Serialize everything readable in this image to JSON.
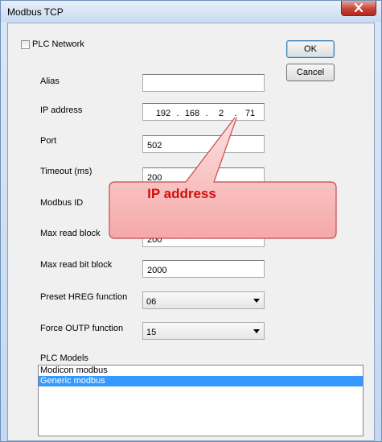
{
  "window": {
    "title": "Modbus TCP"
  },
  "plc_network": {
    "label": "PLC Network",
    "checked": false
  },
  "buttons": {
    "ok": "OK",
    "cancel": "Cancel"
  },
  "fields": {
    "alias": {
      "label": "Alias",
      "value": ""
    },
    "ip_address": {
      "label": "IP address",
      "octets": [
        "192",
        "168",
        "2",
        "71"
      ]
    },
    "port": {
      "label": "Port",
      "value": "502"
    },
    "timeout": {
      "label": "Timeout (ms)",
      "value": "200"
    },
    "modbus_id": {
      "label": "Modbus ID",
      "value": ""
    },
    "max_read_block": {
      "label": "Max read block",
      "value": "200"
    },
    "max_read_bit_block": {
      "label": "Max read bit block",
      "value": "2000"
    },
    "preset_hreg": {
      "label": "Preset HREG function",
      "value": "06"
    },
    "force_outp": {
      "label": "Force OUTP function",
      "value": "15"
    }
  },
  "plc_models": {
    "label": "PLC Models",
    "items": [
      "Modicon modbus",
      "Generic modbus"
    ],
    "selected_index": 1
  },
  "callout": {
    "text": "IP address",
    "color": "#d10f0f"
  }
}
